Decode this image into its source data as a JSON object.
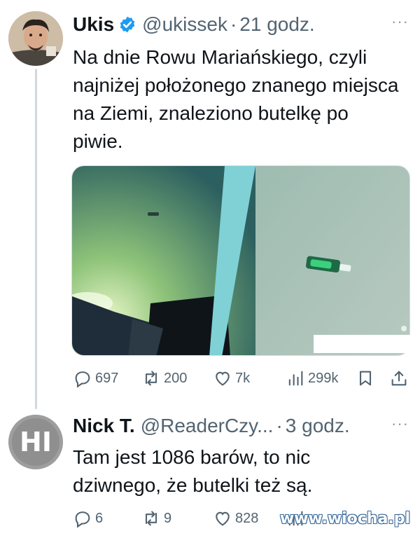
{
  "tweet1": {
    "name": "Ukis",
    "handle": "@ukissek",
    "dot": "·",
    "time": "21 godz.",
    "more": "···",
    "text": "Na dnie Rowu Mariańskiego, czyli najniżej położonego znanego miejsca na Ziemi, znaleziono butelkę po piwie.",
    "replies": "697",
    "retweets": "200",
    "likes": "7k",
    "views": "299k"
  },
  "tweet2": {
    "avatar_text": "HI",
    "name": "Nick T.",
    "handle": "@ReaderCzy...",
    "dot": "·",
    "time": "3 godz.",
    "more": "···",
    "text": "Tam jest 1086 barów, to nic dziwnego, że butelki też są.",
    "replies": "6",
    "retweets": "9",
    "likes": "828"
  },
  "watermark": "www.wiocha.pl",
  "colors": {
    "text": "#0f1419",
    "secondary": "#536471",
    "verified": "#1d9bf0",
    "thread_line": "#cfd9de"
  }
}
